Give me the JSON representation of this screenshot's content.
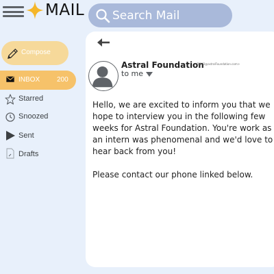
{
  "header": {
    "menu_icon": "hamburger-menu-icon",
    "logo_icon": "four-point-star-icon",
    "logo_text": "MAIL",
    "search": {
      "placeholder": "Search Mail",
      "value": "",
      "icon": "search-icon"
    }
  },
  "sidebar": {
    "compose": {
      "label": "Compose",
      "icon": "pencil-icon"
    },
    "items": [
      {
        "label": "INBOX",
        "count": "200",
        "icon": "envelope-icon",
        "active": true
      },
      {
        "label": "Starred",
        "icon": "star-icon"
      },
      {
        "label": "Snoozed",
        "icon": "clock-icon"
      },
      {
        "label": "Sent",
        "icon": "send-icon"
      },
      {
        "label": "Drafts",
        "icon": "draft-icon"
      }
    ]
  },
  "message": {
    "back_icon": "arrow-left-icon",
    "sender_name": "Astral Foundation",
    "sender_email": "<DNVO@astralFoundation.com>",
    "recipient_label": "to me",
    "avatar_icon": "person-avatar-icon",
    "paragraphs": [
      "Hello, we are excited to inform you that we hope to interview you in the following few weeks for Astral Foundation. You're work as an intern was phenomenal and we'd love to hear back from you!",
      "Please contact our phone linked below."
    ]
  },
  "colors": {
    "background": "#e8f0fb",
    "search_bar": "#a9b9da",
    "compose_button": "#f6d99a",
    "active_nav": "#f6c26a",
    "logo_star": "#f5b629",
    "panel": "#ffffff"
  }
}
